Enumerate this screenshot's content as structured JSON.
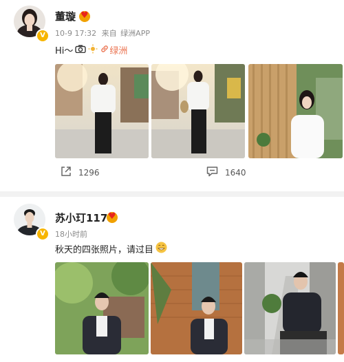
{
  "post1": {
    "name": "董璇",
    "time": "10-9 17:32",
    "source_prefix": "来自",
    "source": "绿洲APP",
    "text_prefix": "Hi～",
    "link_text": "绿洲",
    "repost_count": "1296",
    "comment_count": "1640"
  },
  "post2": {
    "name": "苏小玎117",
    "time": "18小时前",
    "text": "秋天的四张照片，请过目"
  },
  "icons": {
    "verified": "verified-badge-icon",
    "repost": "repost-icon",
    "comment": "comment-icon",
    "camera": "camera-icon",
    "link": "link-icon",
    "emoji": "grin-emoji-icon"
  },
  "colors": {
    "accent_link": "#eb7350",
    "verified": "#f7b500",
    "meta_text": "#8a8a8a"
  }
}
